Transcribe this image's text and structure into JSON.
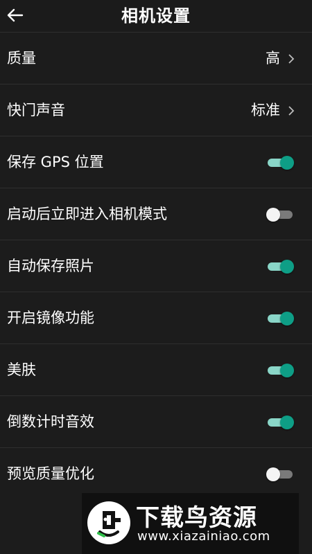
{
  "header": {
    "title": "相机设置",
    "back_icon": "arrow-left-icon"
  },
  "settings": [
    {
      "label": "质量",
      "type": "value",
      "value": "高"
    },
    {
      "label": "快门声音",
      "type": "value",
      "value": "标准"
    },
    {
      "label": "保存 GPS 位置",
      "type": "toggle",
      "on": true
    },
    {
      "label": "启动后立即进入相机模式",
      "type": "toggle",
      "on": false
    },
    {
      "label": "自动保存照片",
      "type": "toggle",
      "on": true
    },
    {
      "label": "开启镜像功能",
      "type": "toggle",
      "on": true
    },
    {
      "label": "美肤",
      "type": "toggle",
      "on": true
    },
    {
      "label": "倒数计时音效",
      "type": "toggle",
      "on": true
    },
    {
      "label": "预览质量优化",
      "type": "toggle",
      "on": false
    }
  ],
  "colors": {
    "background": "#1c1c1c",
    "toggle_on": "#0e9e86",
    "toggle_on_track": "#8ad6c8",
    "toggle_off_track": "#7a7a7a"
  },
  "watermark": {
    "title": "下载鸟资源",
    "url": "www.xiazainiao.com",
    "logo_icon": "bird-logo-icon"
  }
}
